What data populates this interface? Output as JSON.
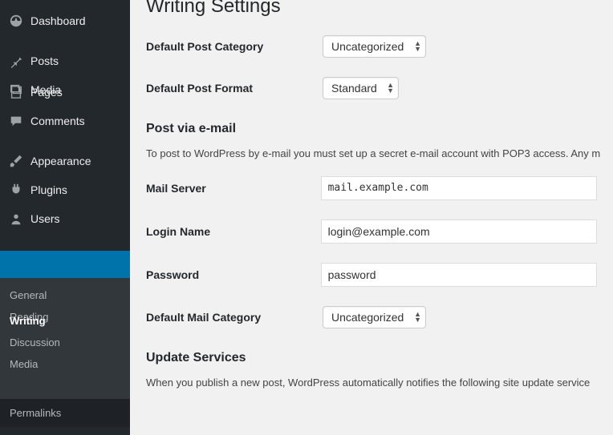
{
  "sidebar": {
    "items": [
      {
        "label": "Dashboard"
      },
      {
        "label": "Posts"
      },
      {
        "label": "Media"
      },
      {
        "label": "Pages"
      },
      {
        "label": "Comments"
      },
      {
        "label": "Appearance"
      },
      {
        "label": "Plugins"
      },
      {
        "label": "Users"
      }
    ],
    "submenu": [
      {
        "label": "General"
      },
      {
        "label": "Reading"
      },
      {
        "label": "Writing"
      },
      {
        "label": "Discussion"
      },
      {
        "label": "Media"
      }
    ],
    "footer": {
      "label": "Permalinks"
    }
  },
  "page": {
    "title": "Writing Settings",
    "section_email": "Post via e-mail",
    "section_update": "Update Services",
    "email_desc": "To post to WordPress by e-mail you must set up a secret e-mail account with POP3 access. Any m",
    "update_desc": "When you publish a new post, WordPress automatically notifies the following site update service"
  },
  "form": {
    "default_category": {
      "label": "Default Post Category",
      "value": "Uncategorized"
    },
    "default_format": {
      "label": "Default Post Format",
      "value": "Standard"
    },
    "mail_server": {
      "label": "Mail Server",
      "value": "mail.example.com"
    },
    "login_name": {
      "label": "Login Name",
      "value": "login@example.com"
    },
    "password": {
      "label": "Password",
      "value": "password"
    },
    "mail_category": {
      "label": "Default Mail Category",
      "value": "Uncategorized"
    }
  }
}
